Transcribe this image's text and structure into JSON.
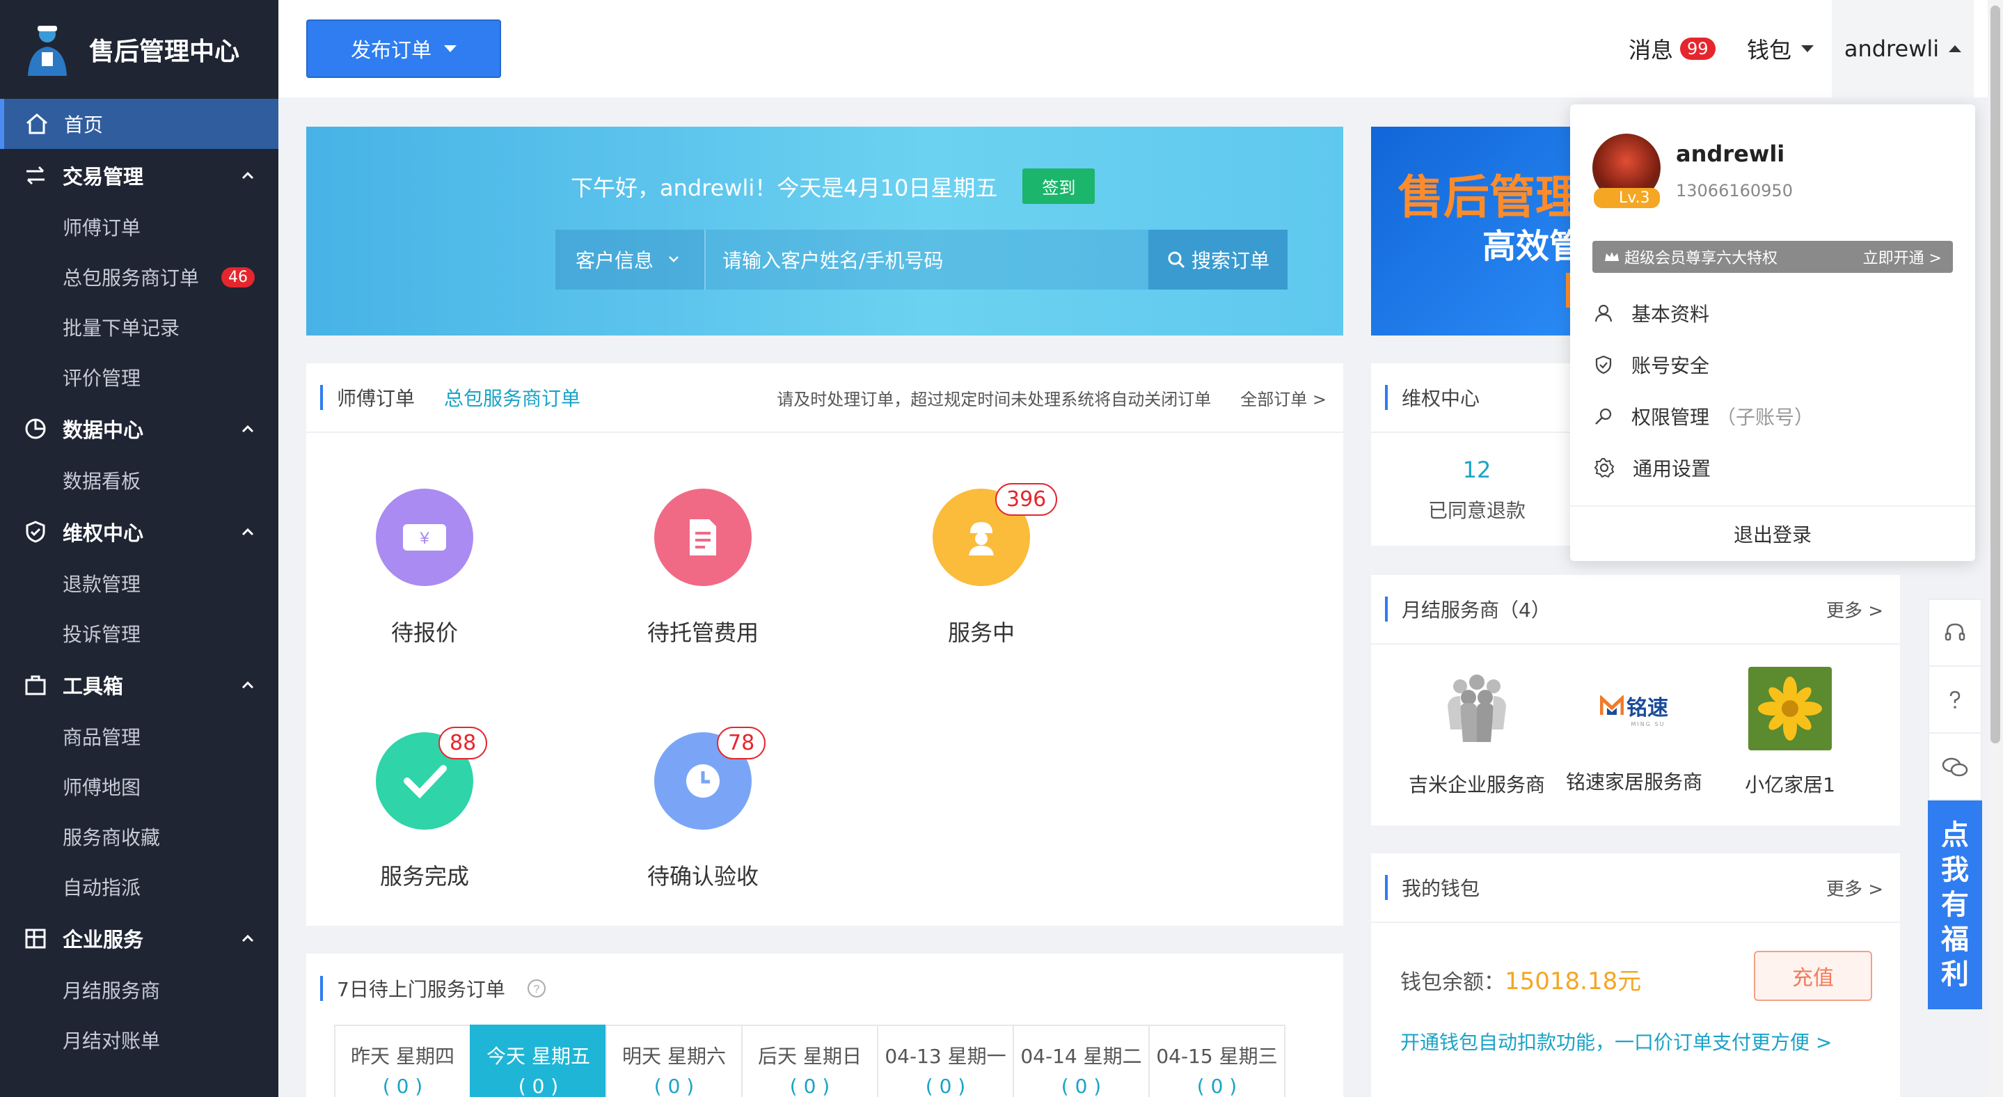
{
  "sidebar": {
    "title": "售后管理中心",
    "home": "首页",
    "groups": [
      {
        "label": "交易管理",
        "items": [
          "师傅订单",
          "总包服务商订单",
          "批量下单记录",
          "评价管理"
        ]
      },
      {
        "label": "数据中心",
        "items": [
          "数据看板"
        ]
      },
      {
        "label": "维权中心",
        "items": [
          "退款管理",
          "投诉管理"
        ]
      },
      {
        "label": "工具箱",
        "items": [
          "商品管理",
          "师傅地图",
          "服务商收藏",
          "自动指派"
        ]
      },
      {
        "label": "企业服务",
        "items": [
          "月结服务商",
          "月结对账单"
        ]
      }
    ],
    "badge_contractor_orders": "46"
  },
  "topbar": {
    "publish": "发布订单",
    "messages": "消息",
    "messages_badge": "99",
    "wallet": "钱包",
    "user": "andrewli"
  },
  "banner": {
    "greeting": "下午好，andrewli！今天是4月10日星期五",
    "signin": "签到",
    "search_category": "客户信息",
    "search_placeholder": "请输入客户姓名/手机号码",
    "search_button": "搜索订单"
  },
  "ad": {
    "line1": "售后管理",
    "line2": "高效管"
  },
  "orders": {
    "title": "师傅订单",
    "tab2": "总包服务商订单",
    "note": "请及时处理订单，超过规定时间未处理系统将自动关闭订单",
    "all": "全部订单 >",
    "tiles": [
      {
        "label": "待报价",
        "count": "",
        "color": "#a98bf1"
      },
      {
        "label": "待托管费用",
        "count": "",
        "color": "#f06a86"
      },
      {
        "label": "服务中",
        "count": "396",
        "color": "#fbbb3b"
      },
      {
        "label": "服务完成",
        "count": "88",
        "color": "#2fd4a8"
      },
      {
        "label": "待确认验收",
        "count": "78",
        "color": "#7aa5f7"
      }
    ]
  },
  "seven": {
    "title": "7日待上门服务订单",
    "days": [
      {
        "label": "昨天 星期四",
        "n": "( 0 )"
      },
      {
        "label": "今天 星期五",
        "n": "( 0 )"
      },
      {
        "label": "明天 星期六",
        "n": "( 0 )"
      },
      {
        "label": "后天 星期日",
        "n": "( 0 )"
      },
      {
        "label": "04-13 星期一",
        "n": "( 0 )"
      },
      {
        "label": "04-14 星期二",
        "n": "( 0 )"
      },
      {
        "label": "04-15 星期三",
        "n": "( 0 )"
      }
    ]
  },
  "rights": {
    "title": "维权中心",
    "stat_value": "12",
    "stat_label": "已同意退款"
  },
  "monthly": {
    "title": "月结服务商（4）",
    "more": "更多 >",
    "providers": [
      "吉米企业服务商",
      "铭速家居服务商",
      "小亿家居1"
    ],
    "logo_text": "铭速",
    "logo_sub": "MING SU"
  },
  "mywallet": {
    "title": "我的钱包",
    "more": "更多 >",
    "balance_label": "钱包余额：",
    "balance": "15018.18元",
    "recharge": "充值",
    "autopay": "开通钱包自动扣款功能，一口价订单支付更方便 >"
  },
  "welfare": [
    "点",
    "我",
    "有",
    "福",
    "利"
  ],
  "dropdown": {
    "name": "andrewli",
    "phone": "13066160950",
    "level": "Lv.3",
    "vip": "超级会员尊享六大特权",
    "vip_open": "立即开通 >",
    "items": [
      "基本资料",
      "账号安全",
      "权限管理",
      "通用设置"
    ],
    "perm_sub": "（子账号）",
    "logout": "退出登录"
  }
}
